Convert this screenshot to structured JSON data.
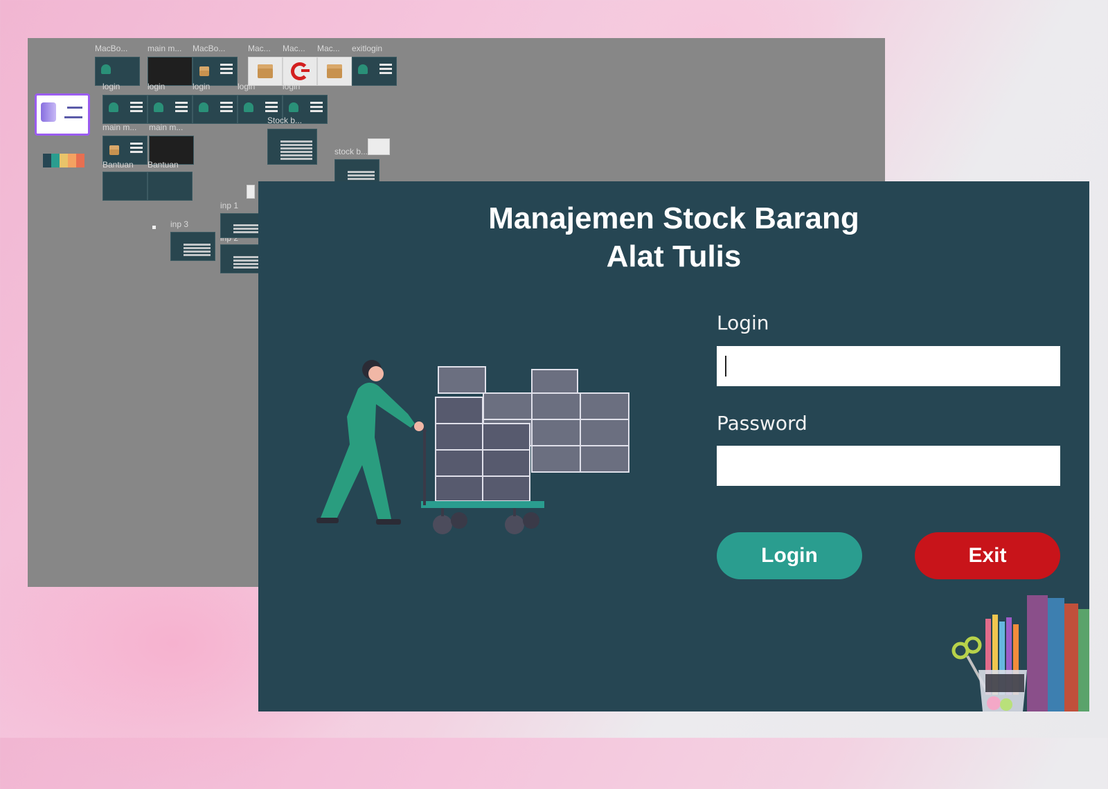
{
  "canvas": {
    "frames": [
      {
        "label": "MacBo..."
      },
      {
        "label": "main m..."
      },
      {
        "label": "MacBo..."
      },
      {
        "label": "Mac..."
      },
      {
        "label": "Mac..."
      },
      {
        "label": "Mac..."
      },
      {
        "label": "exitlogin"
      },
      {
        "label": "login"
      },
      {
        "label": "login"
      },
      {
        "label": "login"
      },
      {
        "label": "login"
      },
      {
        "label": "login"
      },
      {
        "label": "main m..."
      },
      {
        "label": "main m..."
      },
      {
        "label": "Stock b..."
      },
      {
        "label": "stock b..."
      },
      {
        "label": "Bantuan"
      },
      {
        "label": "Bantuan"
      },
      {
        "label": "inp 1"
      },
      {
        "label": "inp 3"
      },
      {
        "label": "inp 2"
      }
    ],
    "palette_colors": [
      "#264653",
      "#2a9d8f",
      "#e9c46a",
      "#f4a261",
      "#e76f51"
    ]
  },
  "app": {
    "title_line1": "Manajemen Stock Barang",
    "title_line2": "Alat Tulis",
    "login_label": "Login",
    "login_value": "",
    "password_label": "Password",
    "password_value": "",
    "login_button": "Login",
    "exit_button": "Exit",
    "colors": {
      "background": "#264653",
      "login_button": "#2a9d8f",
      "exit_button": "#c8141a",
      "figure": "#2a9d7f",
      "boxes": "#6b6f80"
    }
  }
}
